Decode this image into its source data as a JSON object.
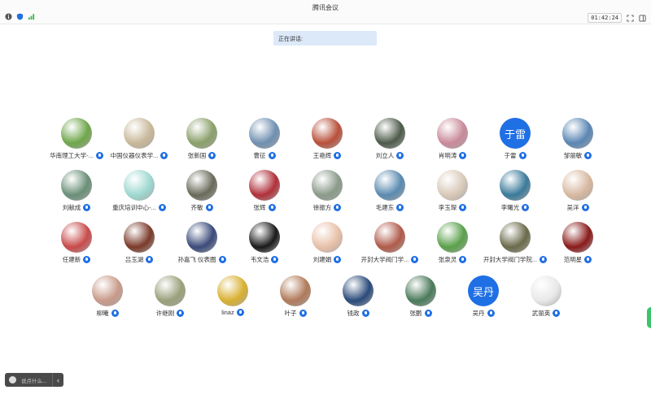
{
  "window": {
    "title": "腾讯会议",
    "timer": "01:42:24"
  },
  "speaking": {
    "label": "正在讲话:"
  },
  "chat": {
    "placeholder": "说点什么...",
    "collapse_glyph": "‹"
  },
  "participants": [
    {
      "name": "华南理工大学-...",
      "color": "#6fa64a"
    },
    {
      "name": "中国仪器仪表学...",
      "color": "#c9b89a"
    },
    {
      "name": "张新国",
      "color": "#8aa06a"
    },
    {
      "name": "曹征",
      "color": "#6f8fb0"
    },
    {
      "name": "王艳辉",
      "color": "#b8503a"
    },
    {
      "name": "刘立人",
      "color": "#4d5b4a"
    },
    {
      "name": "肖明涛",
      "color": "#c98a9a"
    },
    {
      "name": "于雷",
      "text": "于雷",
      "color": "#1f6fe5"
    },
    {
      "name": "邹丽敏",
      "color": "#5a86b4"
    },
    {
      "name": "刘献成",
      "color": "#6a8f78"
    },
    {
      "name": "重庆培训中心-...",
      "color": "#9ed8d0"
    },
    {
      "name": "齐敏",
      "color": "#6a6a5a"
    },
    {
      "name": "张辉",
      "color": "#b0303a"
    },
    {
      "name": "徐振方",
      "color": "#8a9a8a"
    },
    {
      "name": "毛建东",
      "color": "#5a8ab0"
    },
    {
      "name": "李玉琛",
      "color": "#d8c8b8"
    },
    {
      "name": "李曙光",
      "color": "#3a7a9a"
    },
    {
      "name": "吴洋",
      "color": "#d8b8a0"
    },
    {
      "name": "任建新",
      "color": "#c84a4a"
    },
    {
      "name": "吕玉湖",
      "color": "#7a3a2a"
    },
    {
      "name": "孙嘉飞 仪表圈",
      "color": "#3a4a7a"
    },
    {
      "name": "韦文浩",
      "color": "#1a1a1a"
    },
    {
      "name": "刘建娟",
      "color": "#e8c0a8"
    },
    {
      "name": "开封大学阀门学...",
      "color": "#b05a4a"
    },
    {
      "name": "张泉灵",
      "color": "#5aa04a"
    },
    {
      "name": "开封大学阀门学院...",
      "color": "#6a6a4a"
    },
    {
      "name": "范明星",
      "color": "#8a1a1a"
    },
    {
      "name": "柳曦",
      "color": "#c89a8a"
    },
    {
      "name": "许继刚",
      "color": "#9aa07a"
    },
    {
      "name": "linaz",
      "color": "#d8b030"
    },
    {
      "name": "叶子",
      "color": "#b07a5a"
    },
    {
      "name": "钱政",
      "color": "#2a4a7a"
    },
    {
      "name": "张鹏",
      "color": "#4a7a5a"
    },
    {
      "name": "吴丹",
      "text": "吴丹",
      "color": "#1f6fe5"
    },
    {
      "name": "武丽英",
      "color": "#e8e8e8"
    }
  ]
}
